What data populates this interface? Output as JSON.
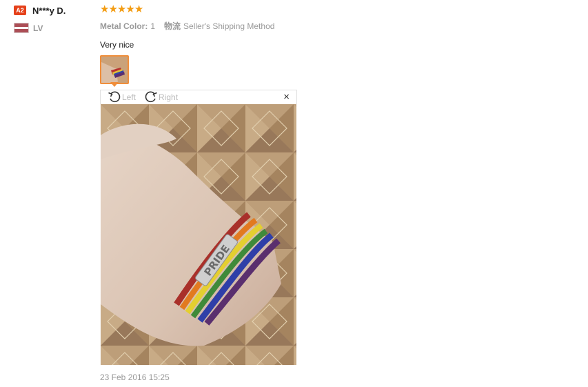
{
  "buyer": {
    "level_badge": "A2",
    "name": "N***y D.",
    "country": "LV"
  },
  "review": {
    "rating": 5,
    "stars": [
      "★",
      "★",
      "★",
      "★",
      "★"
    ],
    "attributes": {
      "metal_color_label": "Metal Color:",
      "metal_color_value": "1",
      "shipping_label": "物流",
      "shipping_value": "Seller's Shipping Method"
    },
    "feedback": "Very nice",
    "date": "23 Feb 2016 15:25"
  },
  "viewer": {
    "rotate_left_label": "Left",
    "rotate_right_label": "Right",
    "rotate_left_icon": "rotate-left-icon",
    "rotate_right_icon": "rotate-right-icon",
    "close_icon": "close-icon",
    "close_glyph": "×",
    "bracelet_text": "PRIDE"
  },
  "colors": {
    "star": "#f39c12",
    "thumb_border": "#f08e3b",
    "badge": "#e5401a"
  }
}
